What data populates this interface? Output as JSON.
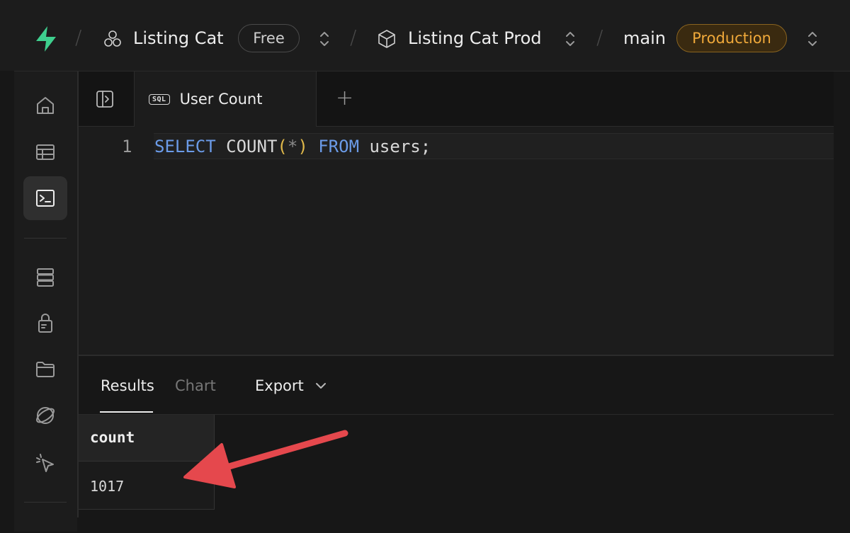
{
  "breadcrumb": {
    "org_name": "Listing Cat",
    "org_plan": "Free",
    "project_name": "Listing Cat Prod",
    "branch_name": "main",
    "branch_env": "Production"
  },
  "sidebar": {
    "items": [
      {
        "icon": "home-icon",
        "active": false
      },
      {
        "icon": "table-editor-icon",
        "active": false
      },
      {
        "icon": "sql-editor-icon",
        "active": true
      },
      {
        "icon": "database-icon",
        "active": false
      },
      {
        "icon": "auth-lock-icon",
        "active": false
      },
      {
        "icon": "storage-folder-icon",
        "active": false
      },
      {
        "icon": "realtime-icon",
        "active": false
      },
      {
        "icon": "pointer-icon",
        "active": false
      }
    ]
  },
  "tabs": {
    "badge": "SQL",
    "active_label": "User Count",
    "add_label": "+"
  },
  "editor": {
    "line_number": "1",
    "code": {
      "select": "SELECT",
      "count": "COUNT",
      "open": "(",
      "star": "*",
      "close": ")",
      "from": "FROM",
      "table": "users;"
    }
  },
  "results": {
    "tabs": {
      "results": "Results",
      "chart": "Chart",
      "export": "Export"
    },
    "columns": [
      "count"
    ],
    "rows": [
      [
        "1017"
      ]
    ]
  },
  "colors": {
    "brand": "#3ecf8e",
    "keyword": "#6b9be8",
    "production": "#f0a93a",
    "arrow": "#e5484d"
  }
}
